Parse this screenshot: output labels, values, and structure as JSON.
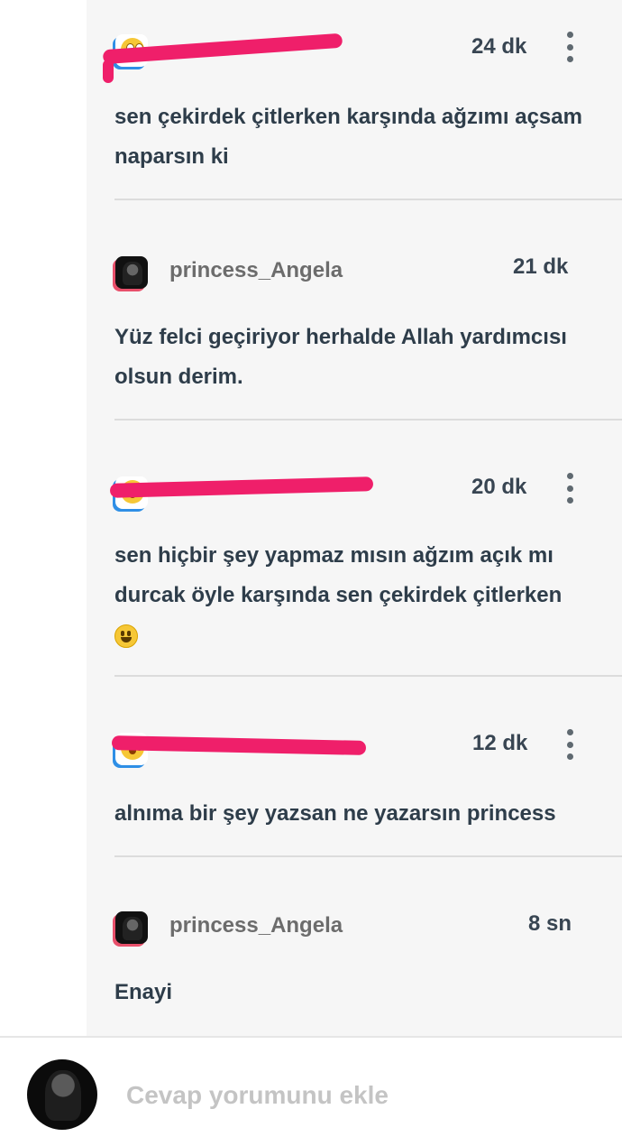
{
  "comments": [
    {
      "username": "",
      "time": "24 dk",
      "text": "sen çekirdek çitlerken karşında ağzımı açsam naparsın ki",
      "avatar": "emoji-avatar",
      "redacted": true,
      "has_more": true
    },
    {
      "username": "princess_Angela",
      "time": "21 dk",
      "text": "Yüz felci geçiriyor herhalde Allah yardımcısı olsun derim.",
      "avatar": "photo-avatar",
      "redacted": false,
      "has_more": false
    },
    {
      "username": "",
      "time": "20 dk",
      "text": "sen hiçbir şey yapmaz mısın ağzım açık mı durcak öyle karşında sen çekirdek çitlerken",
      "trailing_emoji": "smiley-emoji",
      "avatar": "emoji-avatar",
      "redacted": true,
      "has_more": true
    },
    {
      "username": "",
      "time": "12 dk",
      "text": "alnıma bir şey yazsan ne yazarsın princess",
      "avatar": "emoji-avatar",
      "redacted": true,
      "has_more": true
    },
    {
      "username": "princess_Angela",
      "time": "8 sn",
      "text": "Enayi",
      "avatar": "photo-avatar",
      "redacted": false,
      "has_more": false
    }
  ],
  "reply": {
    "placeholder": "Cevap yorumunu ekle",
    "avatar": "photo-avatar"
  },
  "colors": {
    "redaction": "#ef1f6a",
    "thread_background": "#f6f6f6",
    "text": "#2e3d4a",
    "username": "#6c6c6c"
  }
}
